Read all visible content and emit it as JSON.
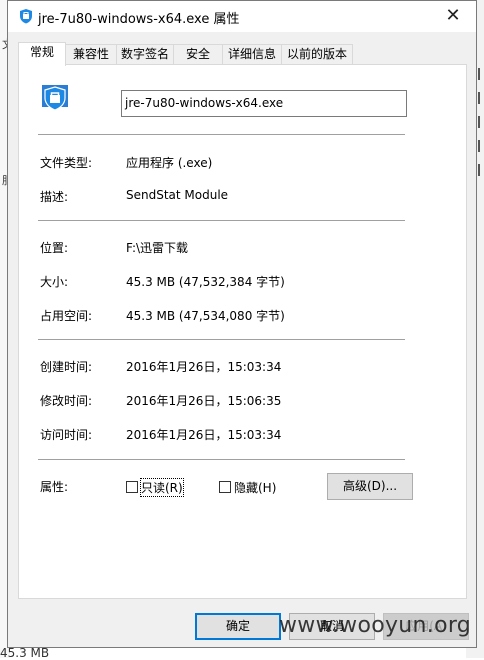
{
  "window": {
    "title": "jre-7u80-windows-x64.exe 属性",
    "close_glyph": "✕"
  },
  "tabs": [
    {
      "label": "常规",
      "active": true
    },
    {
      "label": "兼容性"
    },
    {
      "label": "数字签名"
    },
    {
      "label": "安全"
    },
    {
      "label": "详细信息"
    },
    {
      "label": "以前的版本"
    }
  ],
  "file": {
    "name": "jre-7u80-windows-x64.exe",
    "icon": "shield-app-icon"
  },
  "props": {
    "type_label": "文件类型:",
    "type_value": "应用程序 (.exe)",
    "desc_label": "描述:",
    "desc_value": "SendStat Module",
    "loc_label": "位置:",
    "loc_value": "F:\\迅雷下载",
    "size_label": "大小:",
    "size_value": "45.3 MB (47,532,384 字节)",
    "disk_label": "占用空间:",
    "disk_value": "45.3 MB (47,534,080 字节)",
    "created_label": "创建时间:",
    "created_value": "2016年1月26日，15:03:34",
    "modified_label": "修改时间:",
    "modified_value": "2016年1月26日，15:06:35",
    "accessed_label": "访问时间:",
    "accessed_value": "2016年1月26日，15:03:34",
    "attr_label": "属性:"
  },
  "attributes": {
    "readonly_label": "只读(R)",
    "readonly_checked": false,
    "hidden_label": "隐藏(H)",
    "hidden_checked": false,
    "advanced_label": "高级(D)..."
  },
  "buttons": {
    "ok": "确定",
    "cancel": "取消",
    "apply": "应用(A)"
  },
  "background": {
    "bottom_text": "45.3 MB"
  },
  "watermark": "www.wooyun.org",
  "colors": {
    "accent": "#0078d7",
    "icon_blue": "#1e88e5"
  }
}
